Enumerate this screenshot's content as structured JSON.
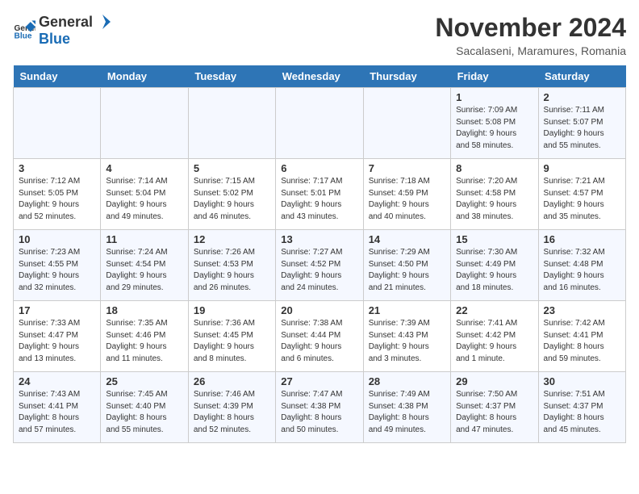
{
  "header": {
    "logo_general": "General",
    "logo_blue": "Blue",
    "month": "November 2024",
    "location": "Sacalaseni, Maramures, Romania"
  },
  "days_of_week": [
    "Sunday",
    "Monday",
    "Tuesday",
    "Wednesday",
    "Thursday",
    "Friday",
    "Saturday"
  ],
  "weeks": [
    [
      {
        "num": "",
        "info": ""
      },
      {
        "num": "",
        "info": ""
      },
      {
        "num": "",
        "info": ""
      },
      {
        "num": "",
        "info": ""
      },
      {
        "num": "",
        "info": ""
      },
      {
        "num": "1",
        "info": "Sunrise: 7:09 AM\nSunset: 5:08 PM\nDaylight: 9 hours\nand 58 minutes."
      },
      {
        "num": "2",
        "info": "Sunrise: 7:11 AM\nSunset: 5:07 PM\nDaylight: 9 hours\nand 55 minutes."
      }
    ],
    [
      {
        "num": "3",
        "info": "Sunrise: 7:12 AM\nSunset: 5:05 PM\nDaylight: 9 hours\nand 52 minutes."
      },
      {
        "num": "4",
        "info": "Sunrise: 7:14 AM\nSunset: 5:04 PM\nDaylight: 9 hours\nand 49 minutes."
      },
      {
        "num": "5",
        "info": "Sunrise: 7:15 AM\nSunset: 5:02 PM\nDaylight: 9 hours\nand 46 minutes."
      },
      {
        "num": "6",
        "info": "Sunrise: 7:17 AM\nSunset: 5:01 PM\nDaylight: 9 hours\nand 43 minutes."
      },
      {
        "num": "7",
        "info": "Sunrise: 7:18 AM\nSunset: 4:59 PM\nDaylight: 9 hours\nand 40 minutes."
      },
      {
        "num": "8",
        "info": "Sunrise: 7:20 AM\nSunset: 4:58 PM\nDaylight: 9 hours\nand 38 minutes."
      },
      {
        "num": "9",
        "info": "Sunrise: 7:21 AM\nSunset: 4:57 PM\nDaylight: 9 hours\nand 35 minutes."
      }
    ],
    [
      {
        "num": "10",
        "info": "Sunrise: 7:23 AM\nSunset: 4:55 PM\nDaylight: 9 hours\nand 32 minutes."
      },
      {
        "num": "11",
        "info": "Sunrise: 7:24 AM\nSunset: 4:54 PM\nDaylight: 9 hours\nand 29 minutes."
      },
      {
        "num": "12",
        "info": "Sunrise: 7:26 AM\nSunset: 4:53 PM\nDaylight: 9 hours\nand 26 minutes."
      },
      {
        "num": "13",
        "info": "Sunrise: 7:27 AM\nSunset: 4:52 PM\nDaylight: 9 hours\nand 24 minutes."
      },
      {
        "num": "14",
        "info": "Sunrise: 7:29 AM\nSunset: 4:50 PM\nDaylight: 9 hours\nand 21 minutes."
      },
      {
        "num": "15",
        "info": "Sunrise: 7:30 AM\nSunset: 4:49 PM\nDaylight: 9 hours\nand 18 minutes."
      },
      {
        "num": "16",
        "info": "Sunrise: 7:32 AM\nSunset: 4:48 PM\nDaylight: 9 hours\nand 16 minutes."
      }
    ],
    [
      {
        "num": "17",
        "info": "Sunrise: 7:33 AM\nSunset: 4:47 PM\nDaylight: 9 hours\nand 13 minutes."
      },
      {
        "num": "18",
        "info": "Sunrise: 7:35 AM\nSunset: 4:46 PM\nDaylight: 9 hours\nand 11 minutes."
      },
      {
        "num": "19",
        "info": "Sunrise: 7:36 AM\nSunset: 4:45 PM\nDaylight: 9 hours\nand 8 minutes."
      },
      {
        "num": "20",
        "info": "Sunrise: 7:38 AM\nSunset: 4:44 PM\nDaylight: 9 hours\nand 6 minutes."
      },
      {
        "num": "21",
        "info": "Sunrise: 7:39 AM\nSunset: 4:43 PM\nDaylight: 9 hours\nand 3 minutes."
      },
      {
        "num": "22",
        "info": "Sunrise: 7:41 AM\nSunset: 4:42 PM\nDaylight: 9 hours\nand 1 minute."
      },
      {
        "num": "23",
        "info": "Sunrise: 7:42 AM\nSunset: 4:41 PM\nDaylight: 8 hours\nand 59 minutes."
      }
    ],
    [
      {
        "num": "24",
        "info": "Sunrise: 7:43 AM\nSunset: 4:41 PM\nDaylight: 8 hours\nand 57 minutes."
      },
      {
        "num": "25",
        "info": "Sunrise: 7:45 AM\nSunset: 4:40 PM\nDaylight: 8 hours\nand 55 minutes."
      },
      {
        "num": "26",
        "info": "Sunrise: 7:46 AM\nSunset: 4:39 PM\nDaylight: 8 hours\nand 52 minutes."
      },
      {
        "num": "27",
        "info": "Sunrise: 7:47 AM\nSunset: 4:38 PM\nDaylight: 8 hours\nand 50 minutes."
      },
      {
        "num": "28",
        "info": "Sunrise: 7:49 AM\nSunset: 4:38 PM\nDaylight: 8 hours\nand 49 minutes."
      },
      {
        "num": "29",
        "info": "Sunrise: 7:50 AM\nSunset: 4:37 PM\nDaylight: 8 hours\nand 47 minutes."
      },
      {
        "num": "30",
        "info": "Sunrise: 7:51 AM\nSunset: 4:37 PM\nDaylight: 8 hours\nand 45 minutes."
      }
    ]
  ]
}
